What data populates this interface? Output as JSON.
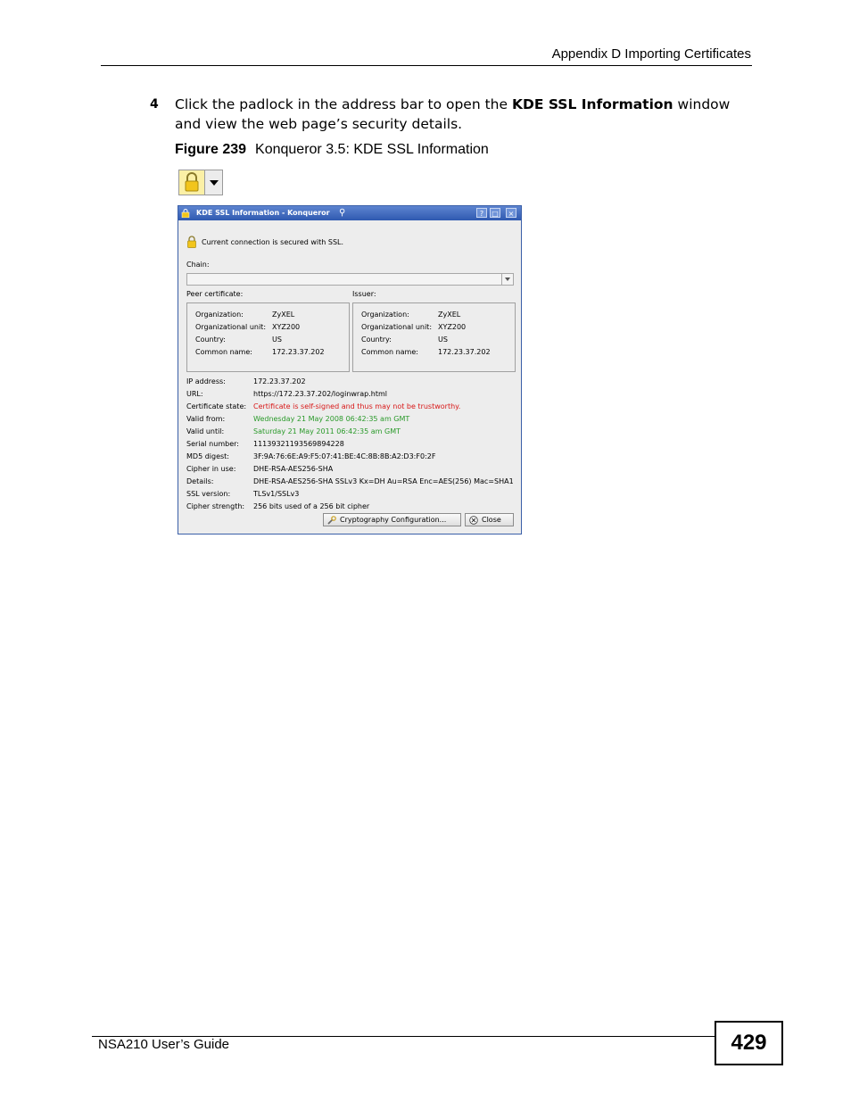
{
  "header": {
    "title": "Appendix D Importing Certificates"
  },
  "step": {
    "number": "4",
    "text_before": "Click the padlock in the address bar to open the ",
    "bold": "KDE SSL Information",
    "text_after": " window and view the web page’s security details."
  },
  "figure": {
    "number": "Figure 239",
    "caption": "Konqueror 3.5: KDE SSL Information"
  },
  "window": {
    "title": "KDE SSL Information - Konqueror",
    "help_btn": "?",
    "max_btn": "□",
    "close_btn": "×",
    "secured_text": "Current connection is secured with SSL.",
    "chain_label": "Chain:",
    "peer_label": "Peer certificate:",
    "issuer_label": "Issuer:",
    "peer": [
      {
        "k": "Organization:",
        "v": "ZyXEL"
      },
      {
        "k": "Organizational unit:",
        "v": "XYZ200"
      },
      {
        "k": "Country:",
        "v": "US"
      },
      {
        "k": "Common name:",
        "v": "172.23.37.202"
      }
    ],
    "issuer": [
      {
        "k": "Organization:",
        "v": "ZyXEL"
      },
      {
        "k": "Organizational unit:",
        "v": "XYZ200"
      },
      {
        "k": "Country:",
        "v": "US"
      },
      {
        "k": "Common name:",
        "v": "172.23.37.202"
      }
    ],
    "details": [
      {
        "k": "IP address:",
        "v": "172.23.37.202",
        "color": "normal"
      },
      {
        "k": "URL:",
        "v": "https://172.23.37.202/loginwrap.html",
        "color": "normal"
      },
      {
        "k": "Certificate state:",
        "v": "Certificate is self-signed and thus may not be trustworthy.",
        "color": "red"
      },
      {
        "k": "Valid from:",
        "v": "Wednesday 21 May 2008 06:42:35 am GMT",
        "color": "green"
      },
      {
        "k": "Valid until:",
        "v": "Saturday 21 May 2011 06:42:35 am GMT",
        "color": "green"
      },
      {
        "k": "Serial number:",
        "v": "11139321193569894228",
        "color": "normal"
      },
      {
        "k": "MD5 digest:",
        "v": "3F:9A:76:6E:A9:F5:07:41:BE:4C:8B:8B:A2:D3:F0:2F",
        "color": "normal"
      },
      {
        "k": "Cipher in use:",
        "v": "DHE-RSA-AES256-SHA",
        "color": "normal"
      },
      {
        "k": "Details:",
        "v": "DHE-RSA-AES256-SHA SSLv3 Kx=DH Au=RSA Enc=AES(256) Mac=SHA1",
        "color": "normal"
      },
      {
        "k": "SSL version:",
        "v": "TLSv1/SSLv3",
        "color": "normal"
      },
      {
        "k": "Cipher strength:",
        "v": "256 bits used of a 256 bit cipher",
        "color": "normal"
      }
    ],
    "crypto_button": "Cryptography Configuration...",
    "close_button": "Close"
  },
  "footer": {
    "guide": "NSA210 User’s Guide",
    "page": "429"
  },
  "colors": {
    "titlebar": "#2f59b0",
    "red_text": "#d81818",
    "green_text": "#2a9a2a"
  }
}
